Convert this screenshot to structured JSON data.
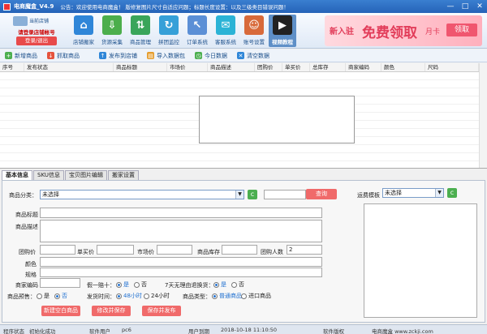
{
  "window": {
    "title": "电商魔盒_V4.9",
    "notice": "公告：欢迎使用电商魔盒！ 版修复图片尺寸自适应问题；标题长度设置：以及三级类目错误问题！",
    "controls": [
      "—",
      "□",
      "✕"
    ]
  },
  "header": {
    "store_label": "当前店铺",
    "login_tip": "请登录店铺帐号",
    "login_button": "登录/退出",
    "modules": [
      {
        "label": "店铺搬家",
        "color": "#2f86d8",
        "icon": "store-move-icon",
        "glyph": "⌂"
      },
      {
        "label": "货源采集",
        "color": "#4cae4c",
        "icon": "download-icon",
        "glyph": "⇩"
      },
      {
        "label": "商品管理",
        "color": "#3aa55a",
        "icon": "sort-icon",
        "glyph": "⇅"
      },
      {
        "label": "拼团监控",
        "color": "#36a0d8",
        "icon": "refresh-icon",
        "glyph": "↻"
      },
      {
        "label": "订单系统",
        "color": "#5b8fd6",
        "icon": "cursor-icon",
        "glyph": "↖"
      },
      {
        "label": "客服系统",
        "color": "#2bb3d6",
        "icon": "chat-icon",
        "glyph": "✉"
      },
      {
        "label": "账号设置",
        "color": "#d86a3a",
        "icon": "user-settings-icon",
        "glyph": "☺"
      },
      {
        "label": "视频教程",
        "color": "#222222",
        "icon": "video-icon",
        "glyph": "▶"
      }
    ],
    "ad": {
      "part1": "新入驻",
      "part2": "免费领取",
      "part3": "月卡",
      "button": "领取"
    }
  },
  "toolbar": [
    {
      "label": "新增商品",
      "icon": "add-icon",
      "color": "#4caf50",
      "glyph": "+"
    },
    {
      "label": "抓取商品",
      "icon": "grab-icon",
      "color": "#e5533d",
      "glyph": "↓"
    },
    {
      "label": "发布到店铺",
      "icon": "publish-icon",
      "color": "#2f86d8",
      "glyph": "↑"
    },
    {
      "label": "导入数据包",
      "icon": "import-icon",
      "color": "#e59c2c",
      "glyph": "▤"
    },
    {
      "label": "今日数据",
      "icon": "today-icon",
      "color": "#4caf50",
      "glyph": "◷"
    },
    {
      "label": "清空数据",
      "icon": "clear-icon",
      "color": "#2f86d8",
      "glyph": "✕"
    }
  ],
  "grid": {
    "columns": [
      "序号",
      "发布状态",
      "商品标题",
      "市场价",
      "商品描述",
      "团购价",
      "单买价",
      "总库存",
      "商家编码",
      "颜色",
      "尺码"
    ]
  },
  "tabs": [
    "基本信息",
    "SKU信息",
    "宝贝图片编辑",
    "搬家设置"
  ],
  "form": {
    "category_label": "商品分类：",
    "category_value": "未选择",
    "search_button": "查询",
    "freight_label": "运费模板",
    "freight_value": "未选择",
    "title_label": "商品标题",
    "desc_label": "商品描述",
    "group_price_label": "团购价",
    "single_price_label": "单买价",
    "market_price_label": "市场价",
    "stock_label": "商品库存",
    "group_count_label": "团购人数",
    "group_count_value": "2",
    "color_label": "颜色",
    "size_label": "规格",
    "code_label": "商家编码",
    "fake_label": "假一赔十：",
    "fake_yes": "是",
    "fake_no": "否",
    "seven_label": "7天无理由退换货：",
    "seven_yes": "是",
    "seven_no": "否",
    "presale_label": "商品预售：",
    "presale_yes": "是",
    "presale_no": "否",
    "ship_label": "发货时间：",
    "ship_48": "48小时",
    "ship_24": "24小时",
    "type_label": "商品类型：",
    "type_normal": "普通商品",
    "type_import": "进口商品",
    "new_button": "新建空白商品",
    "modify_button": "修改并保存",
    "publish_button": "保存并发布"
  },
  "status": {
    "state_label": "程序状态",
    "state_value": "初始化成功",
    "user_label": "软件用户",
    "user_value": "pc6",
    "expire_label": "用户到期",
    "expire_value": "2018-10-18 11:10:50",
    "copyright_label": "软件版权",
    "copyright_value": "电商魔盒 www.zckji.com"
  }
}
